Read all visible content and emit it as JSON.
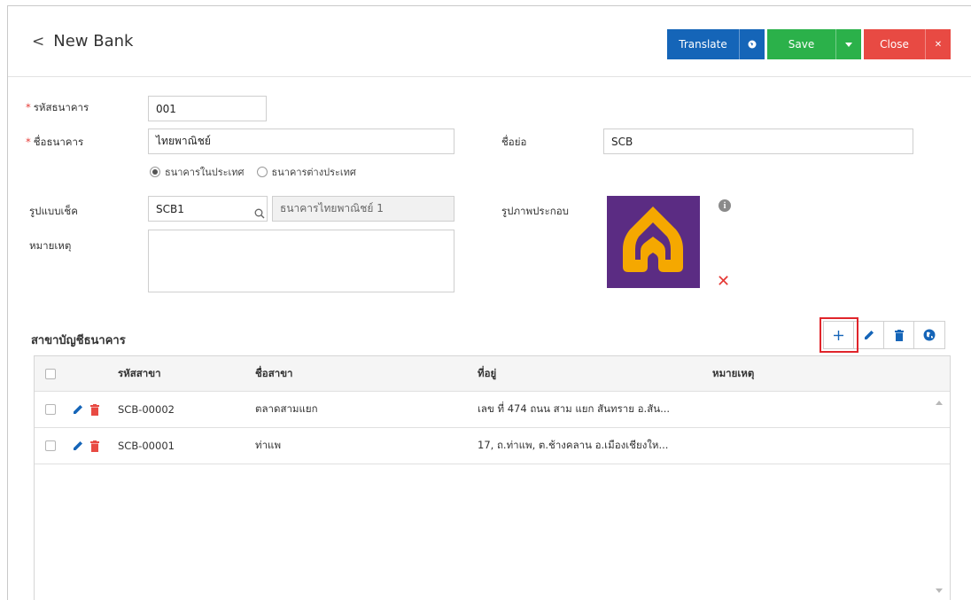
{
  "header": {
    "title": "New Bank",
    "buttons": {
      "translate": "Translate",
      "save": "Save",
      "close": "Close"
    }
  },
  "form": {
    "bank_code": {
      "label": "รหัสธนาคาร",
      "value": "001"
    },
    "bank_name": {
      "label": "ชื่อธนาคาร",
      "value": "ไทยพาณิชย์"
    },
    "short_name": {
      "label": "ชื่อย่อ",
      "value": "SCB"
    },
    "bank_type": {
      "options": [
        "ธนาคารในประเทศ",
        "ธนาคารต่างประเทศ"
      ],
      "selected": "ธนาคารในประเทศ"
    },
    "cheque_format": {
      "label": "รูปแบบเช็ค",
      "code": "SCB1",
      "name": "ธนาคารไทยพาณิชย์ 1"
    },
    "note": {
      "label": "หมายเหตุ",
      "value": ""
    },
    "image": {
      "label": "รูปภาพประกอบ"
    }
  },
  "branches": {
    "title": "สาขาบัญชีธนาคาร",
    "columns": [
      "รหัสสาขา",
      "ชื่อสาขา",
      "ที่อยู่",
      "หมายเหตุ"
    ],
    "rows": [
      {
        "code": "SCB-00002",
        "name": "ตลาดสามแยก",
        "address": "เลข ที่ 474 ถนน สาม แยก สันทราย อ.สัน...",
        "note": ""
      },
      {
        "code": "SCB-00001",
        "name": "ท่าแพ",
        "address": "17, ถ.ท่าแพ, ต.ช้างคลาน อ.เมืองเชียงให...",
        "note": ""
      }
    ]
  },
  "colors": {
    "translate": "#1565b8",
    "save": "#2bb14a",
    "close": "#e84a43",
    "logo_bg": "#5b2c83",
    "logo_fg": "#f5a800"
  }
}
